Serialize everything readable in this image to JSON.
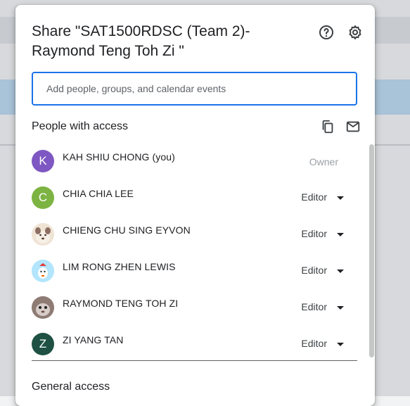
{
  "dialog": {
    "title": "Share \"SAT1500RDSC (Team 2)-Raymond Teng Toh Zi \"",
    "help_icon": "help-circle-icon",
    "settings_icon": "gear-icon"
  },
  "add_people": {
    "placeholder": "Add people, groups, and calendar events",
    "value": ""
  },
  "people_section": {
    "title": "People with access",
    "copy_icon": "copy-icon",
    "mail_icon": "mail-icon",
    "people": [
      {
        "name": "KAH SHIU CHONG (you)",
        "initial": "K",
        "avatar_color": "#7e57c2",
        "email": "",
        "role": "Owner"
      },
      {
        "name": "CHIA CHIA LEE",
        "initial": "C",
        "avatar_color": "#7cb342",
        "email": "",
        "role": "Editor"
      },
      {
        "name": "CHIENG CHU SING EYVON",
        "initial": "",
        "avatar_color": "#8d6e63",
        "email": "",
        "role": "Editor"
      },
      {
        "name": "LIM RONG ZHEN LEWIS",
        "initial": "",
        "avatar_color": "#81d4fa",
        "email": "",
        "role": "Editor"
      },
      {
        "name": "RAYMOND TENG TOH ZI",
        "initial": "",
        "avatar_color": "#9e8c86",
        "email": "",
        "role": "Editor"
      },
      {
        "name": "ZI YANG TAN",
        "initial": "Z",
        "avatar_color": "#1e5143",
        "email": "",
        "role": "Editor"
      }
    ]
  },
  "general_access": {
    "title": "General access"
  }
}
